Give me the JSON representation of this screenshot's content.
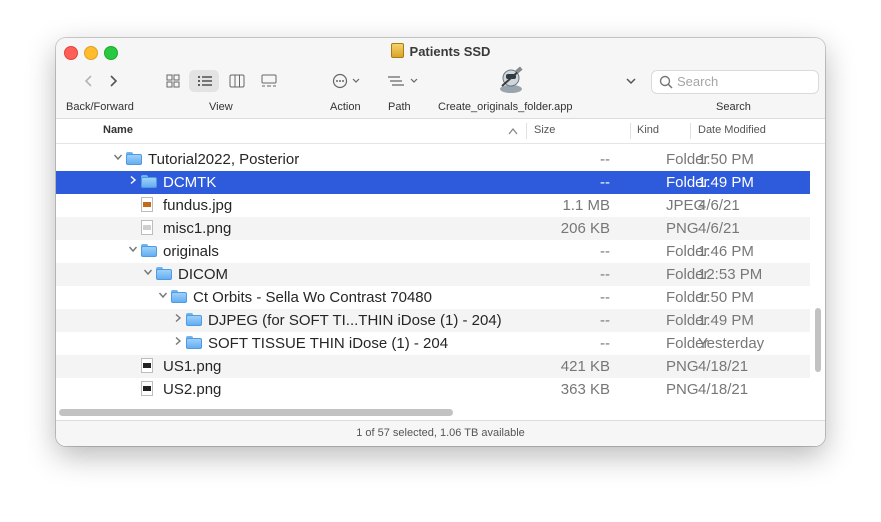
{
  "window": {
    "title": "Patients SSD"
  },
  "toolbar": {
    "back_forward_label": "Back/Forward",
    "view_label": "View",
    "action_label": "Action",
    "path_label": "Path",
    "app_label": "Create_originals_folder.app",
    "search_label": "Search",
    "search_placeholder": "Search"
  },
  "columns": {
    "name": "Name",
    "size": "Size",
    "kind": "Kind",
    "date": "Date Modified"
  },
  "rows": [
    {
      "name": "Tutorial2022, Posterior",
      "size": "--",
      "kind": "Folder",
      "date": "1:50 PM",
      "icon": "folder-icon",
      "level": 0,
      "disclosure": "expanded"
    },
    {
      "name": "DCMTK",
      "size": "--",
      "kind": "Folder",
      "date": "1:49 PM",
      "icon": "folder-icon",
      "level": 1,
      "disclosure": "collapsed",
      "selected": true
    },
    {
      "name": "fundus.jpg",
      "size": "1.1 MB",
      "kind": "JPEG",
      "date": "4/6/21",
      "icon": "jpeg-file-icon",
      "level": 1
    },
    {
      "name": "misc1.png",
      "size": "206 KB",
      "kind": "PNG",
      "date": "4/6/21",
      "icon": "png-file-icon",
      "level": 1
    },
    {
      "name": "originals",
      "size": "--",
      "kind": "Folder",
      "date": "1:46 PM",
      "icon": "folder-icon",
      "level": 1,
      "disclosure": "expanded"
    },
    {
      "name": "DICOM",
      "size": "--",
      "kind": "Folder",
      "date": "12:53 PM",
      "icon": "folder-icon",
      "level": 2,
      "disclosure": "expanded"
    },
    {
      "name": "Ct Orbits - Sella Wo Contrast 70480",
      "size": "--",
      "kind": "Folder",
      "date": "1:50 PM",
      "icon": "folder-icon",
      "level": 3,
      "disclosure": "expanded"
    },
    {
      "name": "DJPEG (for SOFT TI...THIN iDose (1) - 204)",
      "size": "--",
      "kind": "Folder",
      "date": "1:49 PM",
      "icon": "folder-icon",
      "level": 4,
      "disclosure": "collapsed"
    },
    {
      "name": "SOFT TISSUE THIN iDose (1) - 204",
      "size": "--",
      "kind": "Folder",
      "date": "Yesterday",
      "icon": "folder-icon",
      "level": 4,
      "disclosure": "collapsed"
    },
    {
      "name": "US1.png",
      "size": "421 KB",
      "kind": "PNG",
      "date": "4/18/21",
      "icon": "png-file-icon",
      "level": 1
    },
    {
      "name": "US2.png",
      "size": "363 KB",
      "kind": "PNG",
      "date": "4/18/21",
      "icon": "png-file-icon",
      "level": 1
    }
  ],
  "status": {
    "text": "1 of 57 selected, 1.06 TB available"
  },
  "colors": {
    "selection": "#2e5bdb",
    "folder": "#64aef2"
  }
}
